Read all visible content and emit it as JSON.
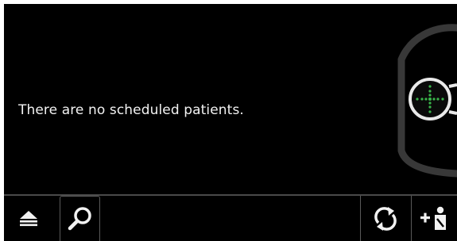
{
  "main": {
    "empty_message": "There are no scheduled patients."
  },
  "toolbar": {
    "items": [
      {
        "name": "menu",
        "icon": "eject-icon"
      },
      {
        "name": "search",
        "icon": "search-icon"
      },
      {
        "name": "refresh",
        "icon": "refresh-icon"
      },
      {
        "name": "add-patient",
        "icon": "add-person-icon"
      }
    ]
  },
  "colors": {
    "background": "#000000",
    "text": "#f2f2f2",
    "outline": "#3a3a3a",
    "target_dots": "#39b54a"
  }
}
